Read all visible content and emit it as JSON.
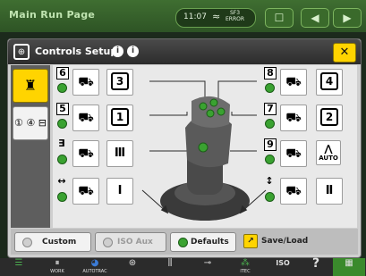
{
  "topbar": {
    "title": "Main Run Page",
    "time": "11:07",
    "wifi": "≈",
    "signal_label": "SF3",
    "error_label": "ERROR",
    "btn_menu": "☐",
    "btn_back": "◀",
    "btn_forward": "▶"
  },
  "dialog": {
    "title": "Controls Setup",
    "help_icon": "i",
    "info_icon": "i",
    "close_label": "✕"
  },
  "left_tabs": [
    {
      "name": "joystick-tab",
      "glyph": "♜"
    },
    {
      "name": "buttons-tab",
      "glyph": "① ④ ⊟"
    }
  ],
  "rows": [
    {
      "num": "6",
      "func": "3"
    },
    {
      "num": "5",
      "func": "1"
    },
    {
      "num": "∃",
      "func": "Ⅲ"
    },
    {
      "num": "↔",
      "func": "Ⅰ"
    }
  ],
  "right_rows": [
    {
      "num": "8",
      "func": "4"
    },
    {
      "num": "7",
      "func": "2"
    },
    {
      "num": "9",
      "func": "AUTO"
    },
    {
      "num": "↕",
      "func": "Ⅱ"
    }
  ],
  "bottom": {
    "custom": "Custom",
    "iso_aux": "ISO Aux",
    "defaults": "Defaults",
    "save_load": "Save/Load"
  },
  "tray": [
    "WORK",
    "AUTOTRAC",
    "",
    "",
    "",
    "ITEC",
    "ISO",
    "",
    ""
  ]
}
